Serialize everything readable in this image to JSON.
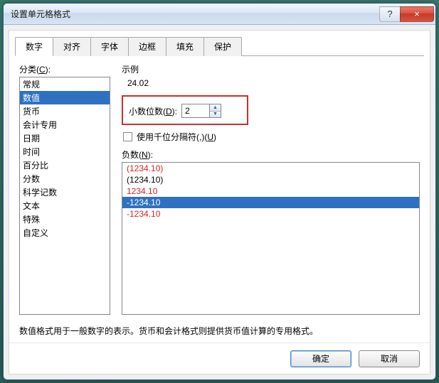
{
  "titlebar": {
    "title": "设置单元格格式",
    "help_symbol": "?",
    "close_symbol": "×"
  },
  "tabs": {
    "items": [
      {
        "label": "数字"
      },
      {
        "label": "对齐"
      },
      {
        "label": "字体"
      },
      {
        "label": "边框"
      },
      {
        "label": "填充"
      },
      {
        "label": "保护"
      }
    ],
    "active_index": 0
  },
  "category": {
    "label_pre": "分类(",
    "label_hot": "C",
    "label_post": "):",
    "items": [
      "常规",
      "数值",
      "货币",
      "会计专用",
      "日期",
      "时间",
      "百分比",
      "分数",
      "科学记数",
      "文本",
      "特殊",
      "自定义"
    ],
    "selected_index": 1
  },
  "example": {
    "label": "示例",
    "value": "24.02"
  },
  "decimals": {
    "label_pre": "小数位数(",
    "label_hot": "D",
    "label_post": "):",
    "value": "2",
    "spin_up": "▲",
    "spin_down": "▼"
  },
  "thousands": {
    "label_pre": "使用千位分隔符(,)(",
    "label_hot": "U",
    "label_post": ")",
    "checked": false
  },
  "negatives": {
    "label_pre": "负数(",
    "label_hot": "N",
    "label_post": "):",
    "items": [
      {
        "text": "(1234.10)",
        "red": true,
        "selected": false
      },
      {
        "text": "(1234.10)",
        "red": false,
        "selected": false
      },
      {
        "text": "1234.10",
        "red": true,
        "selected": false
      },
      {
        "text": "-1234.10",
        "red": false,
        "selected": true
      },
      {
        "text": "-1234.10",
        "red": true,
        "selected": false
      }
    ]
  },
  "description": "数值格式用于一般数字的表示。货币和会计格式则提供货币值计算的专用格式。",
  "footer": {
    "ok": "确定",
    "cancel": "取消"
  }
}
